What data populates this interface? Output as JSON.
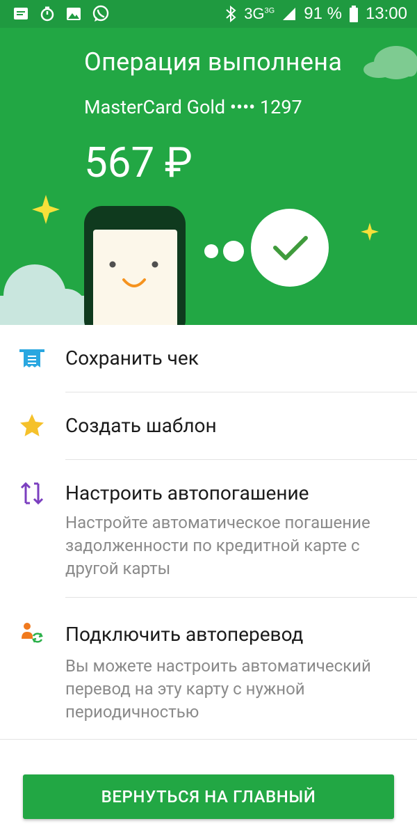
{
  "status_bar": {
    "network": "3G",
    "network_sup": "3G",
    "battery": "91 %",
    "time": "13:00"
  },
  "header": {
    "title": "Операция выполнена",
    "card": "MasterCard Gold •••• 1297",
    "amount": "567 ₽"
  },
  "actions": [
    {
      "title": "Сохранить чек",
      "icon": "receipt-icon"
    },
    {
      "title": "Создать шаблон",
      "icon": "star-icon"
    },
    {
      "title": "Настроить автопогашение",
      "icon": "autopay-arrows-icon",
      "desc": "Настройте автоматическое погашение задолженности по кредитной карте с другой карты"
    },
    {
      "title": "Подключить автоперевод",
      "icon": "autotransfer-person-icon",
      "desc": "Вы можете настроить автоматический перевод на эту карту с нужной периодичностью"
    }
  ],
  "button": {
    "label": "ВЕРНУТЬСЯ НА ГЛАВНЫЙ"
  },
  "colors": {
    "brand_green": "#22a744",
    "status_green": "#1f9a40",
    "receipt_blue": "#2aa7e0",
    "star_yellow": "#f5c12b",
    "autopay_purple": "#7b3fbf",
    "transfer_orange": "#f07a1e"
  }
}
